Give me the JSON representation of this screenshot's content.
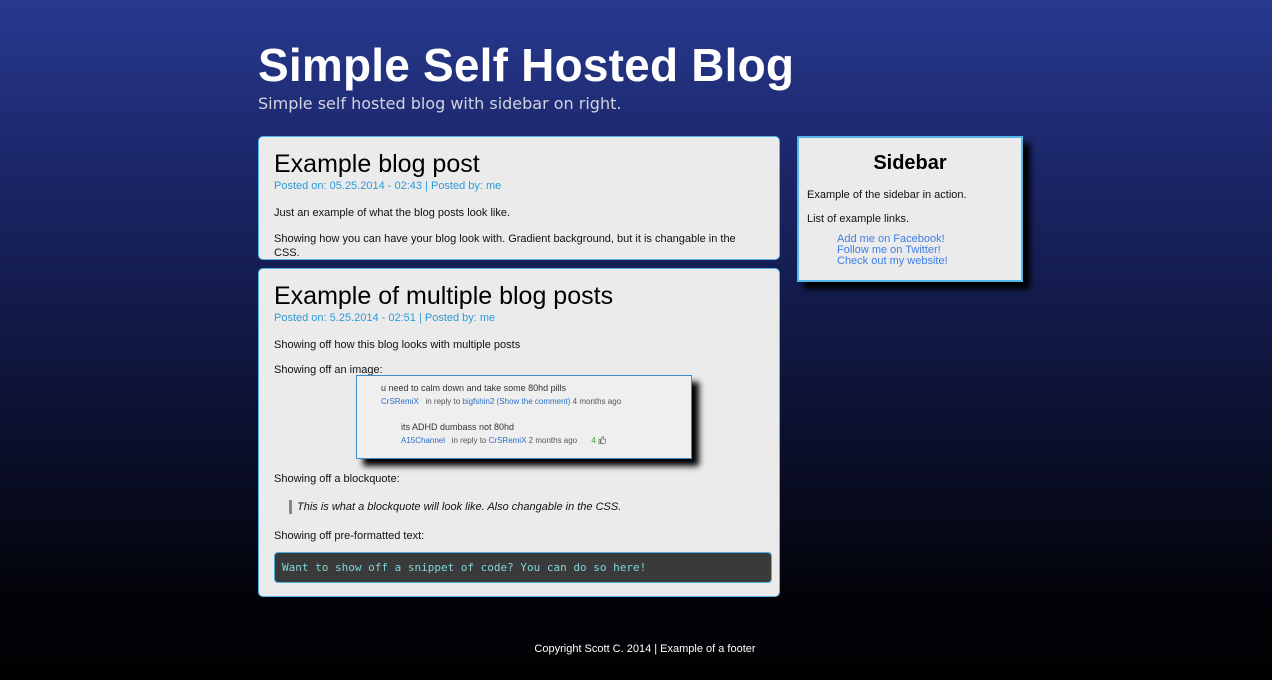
{
  "header": {
    "title": "Simple Self Hosted Blog",
    "subtitle": "Simple self hosted blog with sidebar on right."
  },
  "posts": [
    {
      "title": "Example blog post",
      "meta": "Posted on: 05.25.2014 - 02:43 | Posted by: me",
      "paragraphs": [
        "Just an example of what the blog posts look like.",
        "Showing how you can have your blog look with. Gradient background, but it is changable in the CSS."
      ]
    },
    {
      "title": "Example of multiple blog posts",
      "meta": "Posted on: 5.25.2014 - 02:51 | Posted by: me",
      "paragraphs": [
        "Showing off how this blog looks with multiple posts",
        "Showing off an image:",
        "Showing off a blockquote:",
        "Showing off pre-formatted text:"
      ],
      "blockquote": "This is what a blockquote will look like. Also changable in the CSS.",
      "pre": "Want to show off a snippet of code? You can do so here!",
      "image": {
        "comment1": {
          "text": "u need to calm down and take some 80hd pills",
          "author": "CrSRemiX",
          "reply_label": "in reply to",
          "reply_to": "bigfshin2 (Show the comment)",
          "age": "4 months ago"
        },
        "comment2": {
          "text": "its ADHD dumbass not 80hd",
          "author": "A15Channel",
          "reply_label": "in reply to",
          "reply_to": "CrSRemiX",
          "age": "2 months ago",
          "score": "4"
        }
      }
    }
  ],
  "sidebar": {
    "title": "Sidebar",
    "text1": "Example of the sidebar in action.",
    "text2": "List of example links.",
    "links": [
      "Add me on Facebook!",
      "Follow me on Twitter!",
      "Check out my website!"
    ]
  },
  "footer": {
    "text": "Copyright Scott C. 2014 | Example of a footer"
  },
  "colors": {
    "link": "#3f7ee8",
    "meta": "#2e9ad6",
    "border": "#55b6ea",
    "panel": "#ebebeb"
  }
}
